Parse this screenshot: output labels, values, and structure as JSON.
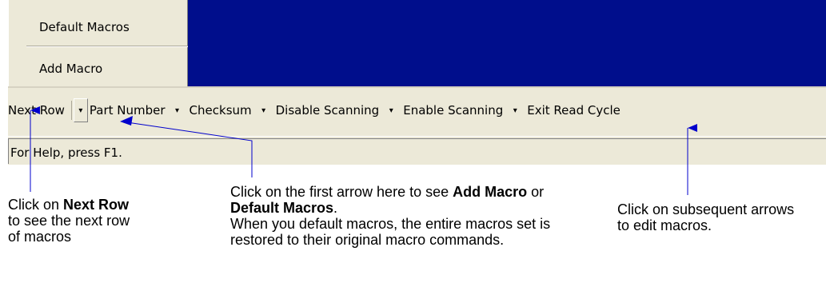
{
  "menu": {
    "items": [
      {
        "label": "Default Macros"
      },
      {
        "label": "Add Macro"
      }
    ]
  },
  "toolbar": {
    "next_row": "Next Row",
    "items": [
      {
        "label": "Part Number"
      },
      {
        "label": "Checksum"
      },
      {
        "label": "Disable Scanning"
      },
      {
        "label": "Enable Scanning"
      },
      {
        "label": "Exit Read Cycle"
      }
    ],
    "arrow_glyph": "▾"
  },
  "status": {
    "text": "For Help, press F1."
  },
  "callouts": {
    "left": {
      "pre": "Click on ",
      "bold": "Next Row",
      "post": " to see the next row of macros"
    },
    "middle": {
      "pre": "Click on the first arrow here to see ",
      "bold1": "Add Macro",
      "mid": " or ",
      "bold2": "Default Macros",
      "post": ".",
      "line2": "When you default macros, the entire macros set is restored to their original macro commands."
    },
    "right": {
      "text": "Click on subsequent arrows to edit macros."
    }
  },
  "colors": {
    "window_bg": "#000e8c",
    "toolbar_bg": "#ece9d8",
    "arrow_line": "#0000cc"
  }
}
